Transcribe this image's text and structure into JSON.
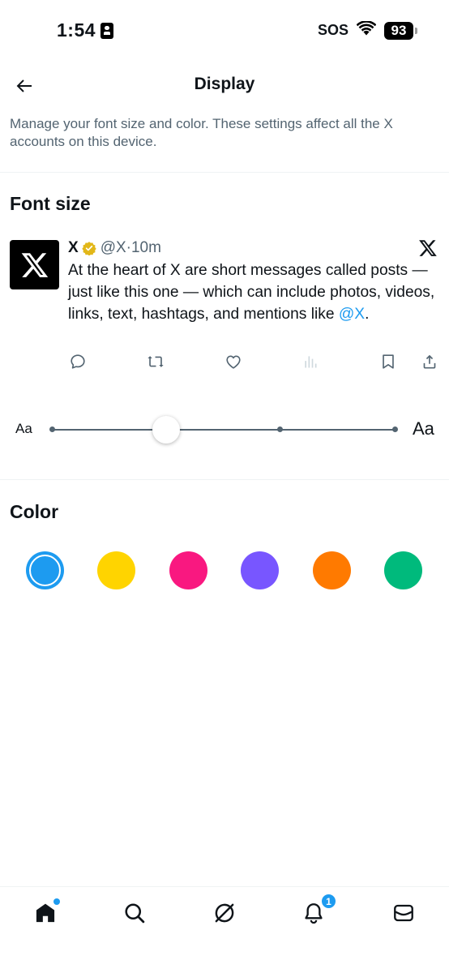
{
  "status_bar": {
    "time": "1:54",
    "sos": "SOS",
    "battery": "93"
  },
  "header": {
    "title": "Display",
    "back_icon": "arrow-left-icon"
  },
  "description": "Manage your font size and color. These settings affect all the X accounts on this device.",
  "font_size": {
    "section_title": "Font size",
    "small_label": "Aa",
    "large_label": "Aa",
    "slider_steps": 5,
    "slider_value_index": 1
  },
  "preview_post": {
    "name": "X",
    "handle": "@X",
    "separator": "·",
    "time": "10m",
    "text": "At the heart of X are short messages called posts — just like this one — which can include photos, videos, links, text, hashtags, and mentions like ",
    "mention": "@X",
    "text_end": ".",
    "actions": [
      "reply-icon",
      "repost-icon",
      "like-icon",
      "views-icon",
      "bookmark-icon",
      "share-icon"
    ]
  },
  "color": {
    "section_title": "Color",
    "options": [
      "#1d9bf0",
      "#ffd400",
      "#f91880",
      "#7856ff",
      "#ff7a00",
      "#00ba7c"
    ],
    "selected_index": 0
  },
  "bottom_nav": {
    "items": [
      "home-icon",
      "search-icon",
      "grok-icon",
      "notifications-icon",
      "messages-icon"
    ],
    "notification_count": "1"
  },
  "colors": {
    "accent": "#1d9bf0",
    "text_primary": "#0f1419",
    "text_secondary": "#536471",
    "divider": "#eff3f4"
  }
}
